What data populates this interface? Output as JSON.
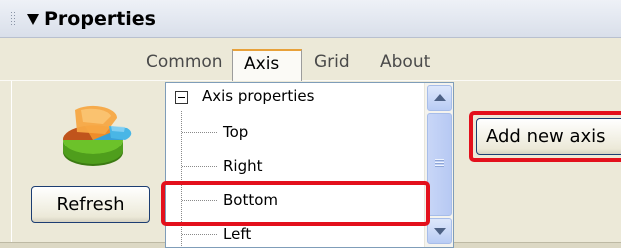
{
  "panel": {
    "title": "Properties"
  },
  "tabs": [
    {
      "label": "Common",
      "active": false
    },
    {
      "label": "Axis",
      "active": true
    },
    {
      "label": "Grid",
      "active": false
    },
    {
      "label": "About",
      "active": false
    }
  ],
  "buttons": {
    "refresh_label": "Refresh",
    "add_axis_label": "Add new axis"
  },
  "tree": {
    "root_label": "Axis properties",
    "items": [
      {
        "label": "Top"
      },
      {
        "label": "Right"
      },
      {
        "label": "Bottom"
      },
      {
        "label": "Left"
      }
    ]
  },
  "colors": {
    "highlight": "#e3101c",
    "panel_bg": "#ece9d8",
    "active_tab_accent": "#e8a13a"
  },
  "icons": {
    "panel_grip": "grip-icon",
    "collapse": "triangle-down-icon",
    "chart": "pie-chart-icon",
    "tree_expander": "minus-box-icon"
  }
}
